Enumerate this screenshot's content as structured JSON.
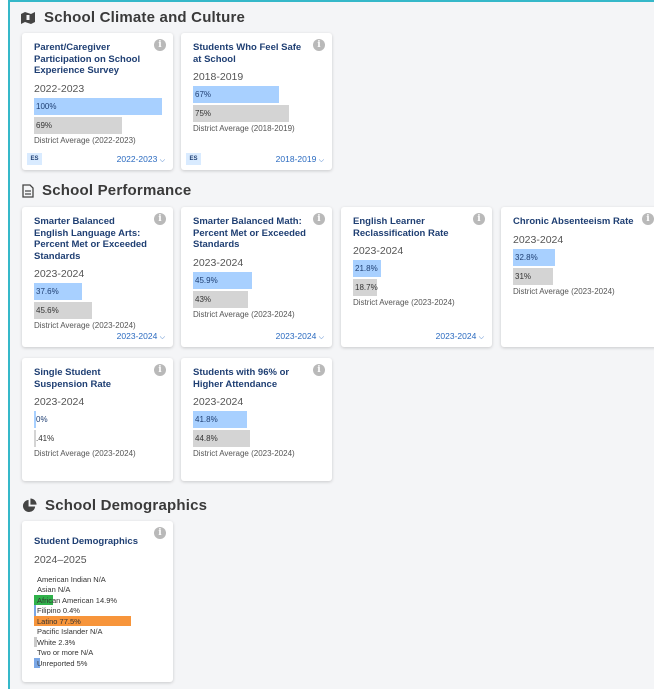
{
  "colors": {
    "school_bar": "#a8d0ff",
    "district_bar": "#d4d4d4",
    "accent": "#35b8c9",
    "title_text": "#1f3f73",
    "link": "#2a6ac0"
  },
  "sections": {
    "climate": {
      "title": "School Climate and Culture",
      "icon": "school-map-icon"
    },
    "performance": {
      "title": "School Performance",
      "icon": "document-icon"
    },
    "demographics": {
      "title": "School Demographics",
      "icon": "pie-chart-icon"
    }
  },
  "cards": [
    {
      "id": "parent-participation",
      "title": "Parent/Caregiver Participation on School Experience Survey",
      "year": "2022-2023",
      "school_value": 100,
      "school_label": "100%",
      "district_value": 69,
      "district_label": "69%",
      "district_caption": "District Average (2022-2023)",
      "badge": "ES",
      "year_select": "2022-2023"
    },
    {
      "id": "students-safe",
      "title": "Students Who Feel Safe at School",
      "year": "2018-2019",
      "school_value": 67,
      "school_label": "67%",
      "district_value": 75,
      "district_label": "75%",
      "district_caption": "District Average (2018-2019)",
      "badge": "ES",
      "year_select": "2018-2019"
    },
    {
      "id": "sbac-ela",
      "title": "Smarter Balanced English Language Arts: Percent Met or Exceeded Standards",
      "year": "2023-2024",
      "school_value": 37.6,
      "school_label": "37.6%",
      "district_value": 45.6,
      "district_label": "45.6%",
      "district_caption": "District Average (2023-2024)",
      "badge": "",
      "year_select": "2023-2024"
    },
    {
      "id": "sbac-math",
      "title": "Smarter Balanced Math: Percent Met or Exceeded Standards",
      "year": "2023-2024",
      "school_value": 45.9,
      "school_label": "45.9%",
      "district_value": 43,
      "district_label": "43%",
      "district_caption": "District Average (2023-2024)",
      "badge": "",
      "year_select": "2023-2024"
    },
    {
      "id": "el-reclass",
      "title": "English Learner Reclassification Rate",
      "year": "2023-2024",
      "school_value": 21.8,
      "school_label": "21.8%",
      "district_value": 18.7,
      "district_label": "18.7%",
      "district_caption": "District Average (2023-2024)",
      "badge": "",
      "year_select": "2023-2024"
    },
    {
      "id": "chronic-absent",
      "title": "Chronic Absenteeism Rate",
      "year": "2023-2024",
      "school_value": 32.8,
      "school_label": "32.8%",
      "district_value": 31,
      "district_label": "31%",
      "district_caption": "District Average (2023-2024)",
      "badge": "",
      "year_select": ""
    },
    {
      "id": "suspension",
      "title": "Single Student Suspension Rate",
      "year": "2023-2024",
      "school_value": 0,
      "school_label": "0%",
      "district_value": 0.41,
      "district_label": ".41%",
      "district_caption": "District Average (2023-2024)",
      "badge": "",
      "year_select": ""
    },
    {
      "id": "attendance",
      "title": "Students with 96% or Higher Attendance",
      "year": "2023-2024",
      "school_value": 41.8,
      "school_label": "41.8%",
      "district_value": 44.8,
      "district_label": "44.8%",
      "district_caption": "District Average (2023-2024)",
      "badge": "",
      "year_select": ""
    }
  ],
  "demographics": {
    "title": "Student Demographics",
    "year": "2024–2025",
    "rows": [
      {
        "label": "American Indian N/A",
        "value": 0,
        "color": ""
      },
      {
        "label": "Asian N/A",
        "value": 0,
        "color": ""
      },
      {
        "label": "African American 14.9%",
        "value": 14.9,
        "color": "#2fb14a"
      },
      {
        "label": "Filipino 0.4%",
        "value": 0.4,
        "color": "#7aa7e6"
      },
      {
        "label": "Latino 77.5%",
        "value": 77.5,
        "color": "#f7953b"
      },
      {
        "label": "Pacific Islander N/A",
        "value": 0,
        "color": ""
      },
      {
        "label": "White 2.3%",
        "value": 2.3,
        "color": "#c9c9c9"
      },
      {
        "label": "Two or more N/A",
        "value": 0,
        "color": ""
      },
      {
        "label": "Unreported 5%",
        "value": 5,
        "color": "#7aa7e6"
      }
    ]
  }
}
